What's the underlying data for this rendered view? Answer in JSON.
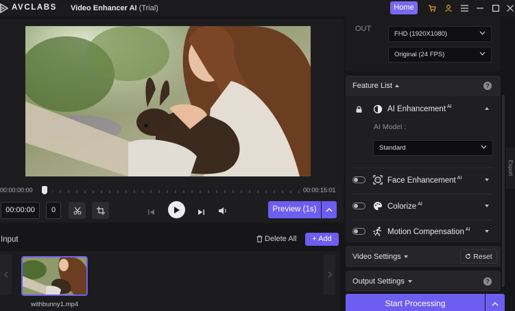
{
  "titlebar": {
    "brand": "AVCLABS",
    "app_name": "Video Enhancer AI",
    "edition": "(Trial)",
    "home_label": "Home"
  },
  "player": {
    "time_start": "00:00:00:00",
    "time_end": "00:00:15:01",
    "current_time": "00:00:00",
    "frame": "0",
    "preview_label": "Preview (1s)"
  },
  "input": {
    "label": "Input",
    "delete_all_label": "Delete All",
    "add_label": "Add",
    "files": [
      {
        "name": "withbunny1.mp4"
      }
    ]
  },
  "output": {
    "label": "OUT",
    "resolution": "FHD (1920X1080)",
    "frame_rate": "Original (24 FPS)"
  },
  "feature_list": {
    "title": "Feature List",
    "ai_enhancement": {
      "label": "AI Enhancement",
      "badge": "AI",
      "model_label": "AI Model :",
      "model_value": "Standard"
    },
    "features": [
      {
        "label": "Face Enhancement",
        "badge": "AI",
        "icon": "face-icon"
      },
      {
        "label": "Colorize",
        "badge": "AI",
        "icon": "palette-icon"
      },
      {
        "label": "Motion Compensation",
        "badge": "AI",
        "icon": "running-icon"
      }
    ]
  },
  "video_settings": {
    "title": "Video Settings",
    "reset_label": "Reset"
  },
  "output_settings": {
    "title": "Output Settings"
  },
  "actions": {
    "start_label": "Start Processing",
    "export_tab": "Export"
  },
  "colors": {
    "accent": "#6d5df0",
    "home_button": "#7b68f2"
  }
}
